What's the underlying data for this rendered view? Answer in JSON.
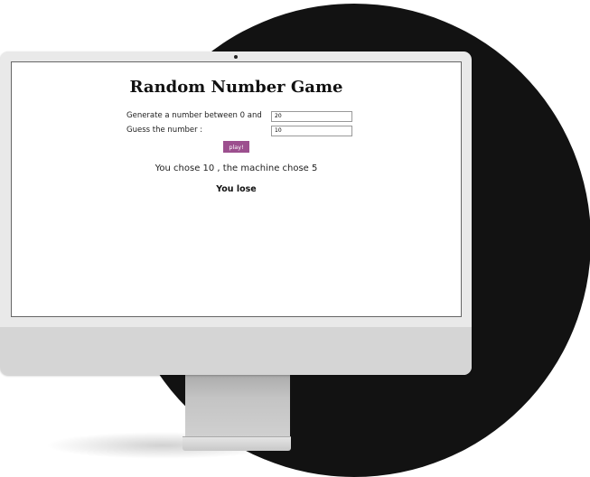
{
  "game": {
    "title": "Random Number Game",
    "range_label": "Generate a number between 0 and",
    "range_value": "20",
    "guess_label": "Guess the number :",
    "guess_value": "10",
    "play_label": "play!",
    "result_text": "You chose 10 , the machine chose 5",
    "verdict": "You lose"
  },
  "colors": {
    "button": "#9c4f8e",
    "circle": "#121212"
  }
}
